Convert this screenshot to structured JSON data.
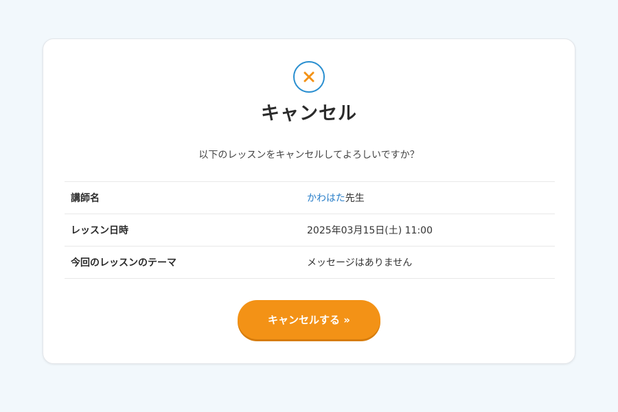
{
  "dialog": {
    "icon": "close-icon",
    "title": "キャンセル",
    "message": "以下のレッスンをキャンセルしてよろしいですか？"
  },
  "details": {
    "teacher": {
      "label": "講師名",
      "name": "かわはた",
      "suffix": "先生"
    },
    "datetime": {
      "label": "レッスン日時",
      "value": "2025年03月15日(土) 11:00"
    },
    "theme": {
      "label": "今回のレッスンのテーマ",
      "value": "メッセージはありません"
    }
  },
  "actions": {
    "cancel_label": "キャンセルする »"
  },
  "colors": {
    "accent": "#f39216",
    "icon_ring": "#2a8fd0",
    "link": "#2a7fc9",
    "background": "#f2f8fc"
  }
}
